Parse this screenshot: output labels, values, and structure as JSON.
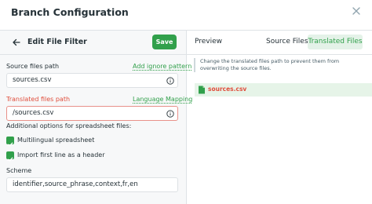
{
  "dialog": {
    "title": "Branch Configuration"
  },
  "left": {
    "back_icon": "arrow-left-icon",
    "title": "Edit File Filter",
    "save_label": "Save",
    "source_files_label": "Source files path",
    "add_ignore_link": "Add ignore pattern",
    "source_files_value": "sources.csv",
    "translated_files_label": "Translated files path",
    "language_mapping_link": "Language Mapping",
    "translated_files_value": "/sources.csv",
    "additional_options_label": "Additional options for spreadsheet files:",
    "multilingual_label": "Multilingual spreadsheet",
    "multilingual_checked": true,
    "import_header_label": "Import first line as a header",
    "import_header_checked": true,
    "scheme_label": "Scheme",
    "scheme_value": "identifier,source_phrase,context,fr,en"
  },
  "right": {
    "tabs": [
      {
        "label": "Preview"
      },
      {
        "label": "Source Files"
      },
      {
        "label": "Translated Files",
        "active": true
      }
    ],
    "notice": "Change the translated files path to prevent them from overwriting the source files.",
    "files": [
      {
        "name": "sources.csv"
      }
    ]
  },
  "colors": {
    "accent": "#31a04b",
    "error": "#e04e3c",
    "active_tab_bg": "#e4f2e8"
  }
}
